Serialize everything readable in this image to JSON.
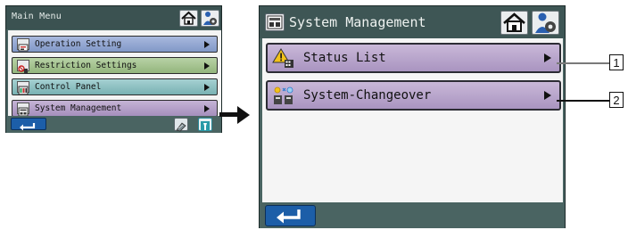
{
  "main_menu": {
    "title": "Main Menu",
    "header_icons": [
      "home-icon",
      "maintenance-person-icon"
    ],
    "items": [
      {
        "label": "Operation Setting",
        "icon": "operation-setting-icon",
        "color": "#8fa4d2"
      },
      {
        "label": "Restriction Settings",
        "icon": "restriction-settings-icon",
        "color": "#a5c590"
      },
      {
        "label": "Control Panel",
        "icon": "control-panel-icon",
        "color": "#8ec2c3"
      },
      {
        "label": "System Management",
        "icon": "system-management-icon",
        "color": "#b4a2c9"
      }
    ],
    "footer_icons": [
      "back-icon",
      "cleaning-icon",
      "service-tool-icon"
    ]
  },
  "system_management": {
    "title": "System Management",
    "header_icons": [
      "system-management-icon",
      "home-icon",
      "maintenance-person-icon"
    ],
    "items": [
      {
        "label": "Status List",
        "icon": "warning-status-icon"
      },
      {
        "label": "System-Changeover",
        "icon": "system-changeover-icon"
      }
    ],
    "footer_icons": [
      "back-icon"
    ]
  },
  "callouts": [
    "1",
    "2"
  ],
  "colors": {
    "panel": "#4a6462",
    "back_button": "#1c5ea8",
    "item_purple": "#b4a2c9"
  }
}
